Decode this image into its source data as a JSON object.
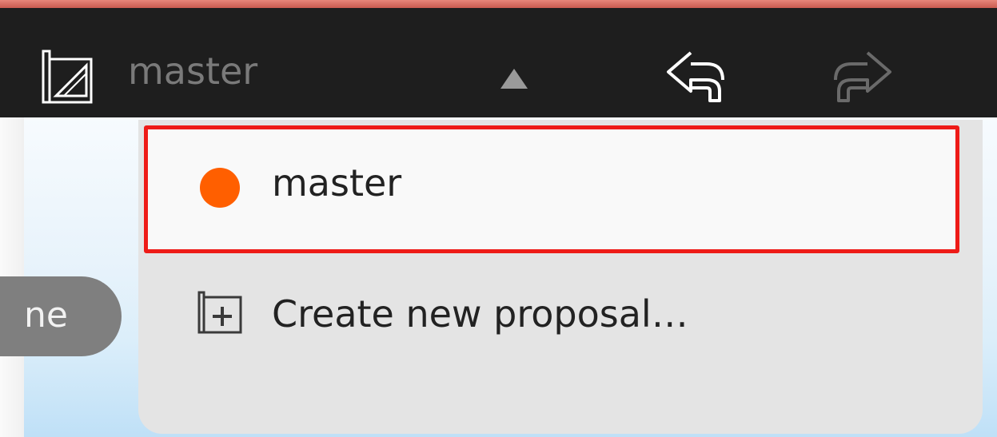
{
  "header": {
    "branch_label": "master",
    "icons": {
      "proposal": "proposal-icon",
      "dropdown": "triangle-up-icon",
      "undo": "undo-icon",
      "redo": "redo-icon"
    }
  },
  "background": {
    "pill_text": "ne"
  },
  "menu": {
    "items": [
      {
        "label": "master",
        "status_color": "#ff5f00",
        "selected": true
      },
      {
        "label": "Create new proposal…",
        "icon": "create-proposal-icon"
      }
    ],
    "highlight_color": "#ee1b17"
  }
}
